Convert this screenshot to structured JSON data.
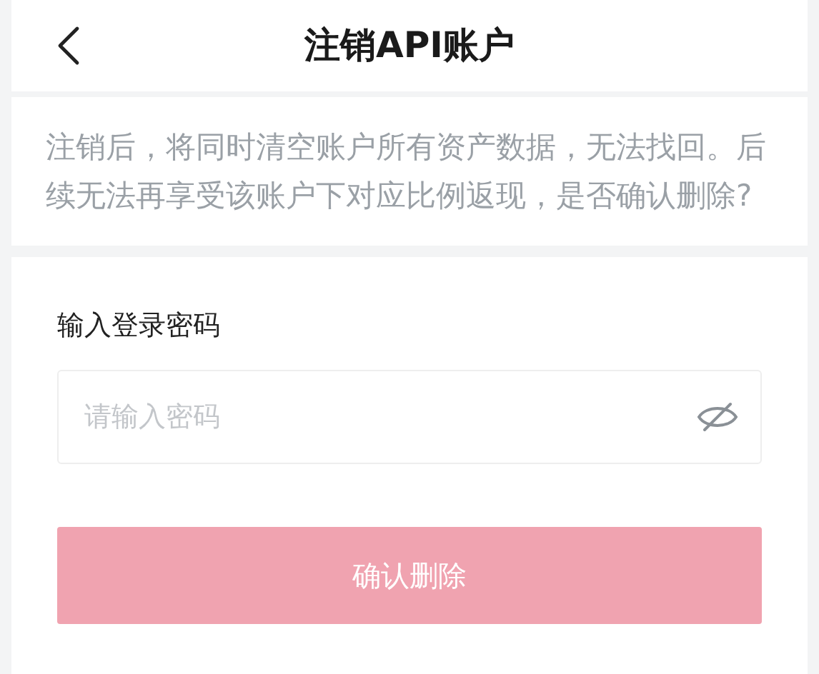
{
  "header": {
    "title": "注销API账户"
  },
  "notice": "注销后，将同时清空账户所有资产数据，无法找回。后续无法再享受该账户下对应比例返现，是否确认删除?",
  "password": {
    "label": "输入登录密码",
    "placeholder": "请输入密码",
    "visible": false
  },
  "confirm_button": {
    "label": "确认删除",
    "disabled": true
  }
}
